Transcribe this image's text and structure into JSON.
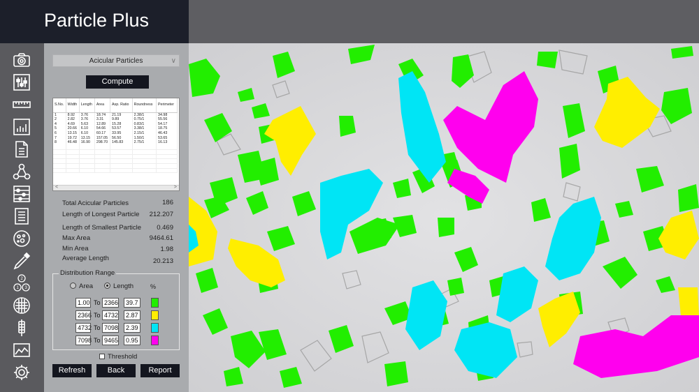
{
  "app": {
    "title": "Particle Plus"
  },
  "sidebar": {
    "icons": [
      "camera-icon",
      "sliders-icon",
      "ruler-icon",
      "bar-chart-icon",
      "document-icon",
      "network-icon",
      "abacus-icon",
      "report-list-icon",
      "cells-icon",
      "pipette-icon",
      "numbered-circles-icon",
      "grid-globe-icon",
      "caliper-icon",
      "area-chart-icon",
      "gear-icon"
    ]
  },
  "panel": {
    "mode_select": "Acicular Particles",
    "compute_label": "Compute",
    "table": {
      "headers": [
        "S.No.",
        "Width",
        "Length",
        "Area",
        "Asp. Ratio",
        "Roundness",
        "Perimeter"
      ],
      "rows": [
        [
          "1",
          "8.92",
          "3.76",
          "18.74",
          "21.19",
          "2.38/1",
          "34.98"
        ],
        [
          "2",
          "2.82",
          "3.76",
          "3.31",
          "9.89",
          "0.75/1",
          "55.56"
        ],
        [
          "4",
          "4.69",
          "5.63",
          "12.89",
          "15.28",
          "0.83/1",
          "54.17"
        ],
        [
          "5",
          "20.66",
          "6.10",
          "54.66",
          "53.57",
          "3.38/1",
          "18.75"
        ],
        [
          "6",
          "13.15",
          "6.10",
          "60.17",
          "33.95",
          "2.15/1",
          "46.43"
        ],
        [
          "7",
          "19.72",
          "13.15",
          "157.05",
          "56.50",
          "1.50/1",
          "53.65"
        ],
        [
          "8",
          "46.48",
          "16.90",
          "298.70",
          "145.83",
          "2.75/1",
          "16.13"
        ]
      ]
    },
    "stats": [
      {
        "label": "Total Acicular Particles",
        "value": "186"
      },
      {
        "label": "Length of Longest Particle",
        "value": "212.207"
      },
      {
        "label": "Length of Smallest Particle",
        "value": "0.469"
      },
      {
        "label": "Max Area",
        "value": "9464.61"
      },
      {
        "label": "Min Area",
        "value": "1.98"
      },
      {
        "label": "Average Length",
        "value": "20.213"
      }
    ],
    "distribution": {
      "title": "Distribution Range",
      "radio_area": "Area",
      "radio_length": "Length",
      "selected": "Length",
      "pct_header": "%",
      "to_label": "To",
      "ranges": [
        {
          "from": "1.00",
          "to": "2366",
          "pct": "39.7",
          "color": "#22ee00"
        },
        {
          "from": "2366",
          "to": "4732",
          "pct": "2.87",
          "color": "#ffee00"
        },
        {
          "from": "4732",
          "to": "7098",
          "pct": "2.39",
          "color": "#00e5f5"
        },
        {
          "from": "7098",
          "to": "9465",
          "pct": "0.95",
          "color": "#ff00ee"
        }
      ]
    },
    "threshold_label": "Threshold",
    "threshold_checked": false,
    "refresh_label": "Refresh",
    "back_label": "Back",
    "report_label": "Report"
  }
}
